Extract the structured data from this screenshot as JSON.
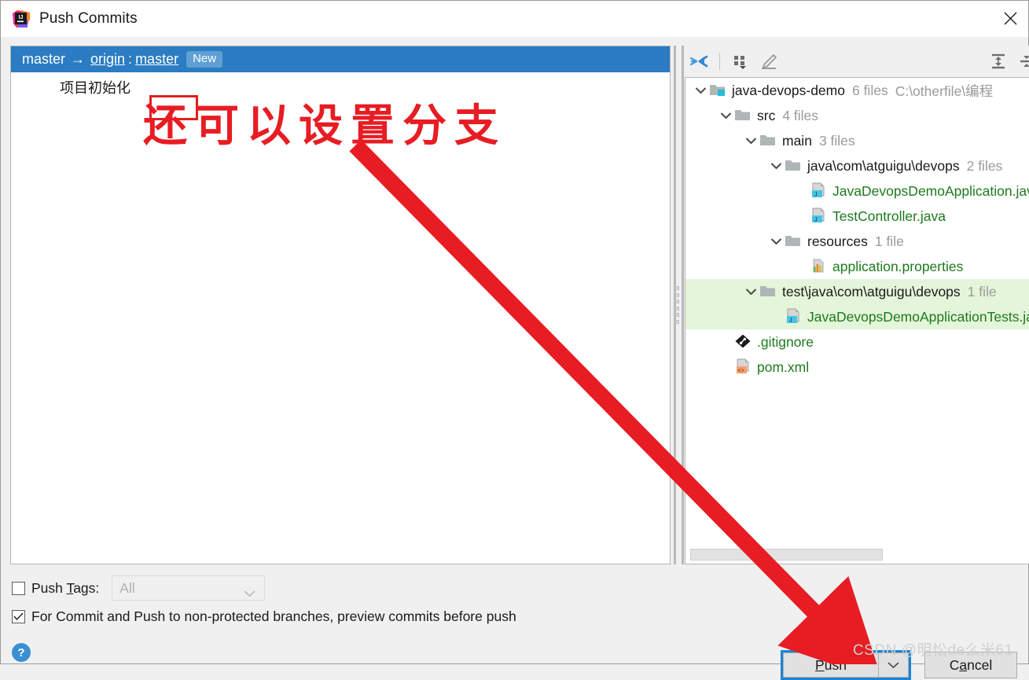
{
  "window": {
    "title": "Push Commits",
    "app_icon": "intellij-idea-icon",
    "close_label": "✕"
  },
  "commits_panel": {
    "header": {
      "local_branch": "master",
      "arrow": "→",
      "remote": "origin",
      "separator": ":",
      "remote_branch": "master",
      "badge": "New"
    },
    "commits": [
      {
        "message": "项目初始化"
      }
    ]
  },
  "tree_toolbar": {
    "buttons": [
      {
        "name": "collapse-all-icon",
        "title": "Collapse All"
      },
      {
        "name": "group-by-icon",
        "title": "Group By"
      },
      {
        "name": "edit-icon",
        "title": "Edit Source"
      },
      {
        "name": "expand-all-icon",
        "title": "Expand All"
      },
      {
        "name": "collapse-icon",
        "title": "Collapse"
      }
    ]
  },
  "file_tree": {
    "nodes": [
      {
        "indent": 0,
        "twisty": "expanded",
        "icon": "module-folder-icon",
        "name": "java-devops-demo",
        "meta": "6 files",
        "path": "C:\\otherfile\\编程",
        "type": "folder",
        "selected": false
      },
      {
        "indent": 1,
        "twisty": "expanded",
        "icon": "folder-icon",
        "name": "src",
        "meta": "4 files",
        "path": "",
        "type": "folder",
        "selected": false
      },
      {
        "indent": 2,
        "twisty": "expanded",
        "icon": "folder-icon",
        "name": "main",
        "meta": "3 files",
        "path": "",
        "type": "folder",
        "selected": false
      },
      {
        "indent": 3,
        "twisty": "expanded",
        "icon": "folder-icon",
        "name": "java\\com\\atguigu\\devops",
        "meta": "2 files",
        "path": "",
        "type": "folder",
        "selected": false
      },
      {
        "indent": 4,
        "twisty": "none",
        "icon": "java-file-icon",
        "name": "JavaDevopsDemoApplication.java",
        "meta": "",
        "path": "",
        "type": "file",
        "selected": false
      },
      {
        "indent": 4,
        "twisty": "none",
        "icon": "java-file-icon",
        "name": "TestController.java",
        "meta": "",
        "path": "",
        "type": "file",
        "selected": false
      },
      {
        "indent": 3,
        "twisty": "expanded",
        "icon": "folder-icon",
        "name": "resources",
        "meta": "1 file",
        "path": "",
        "type": "folder",
        "selected": false
      },
      {
        "indent": 4,
        "twisty": "none",
        "icon": "properties-file-icon",
        "name": "application.properties",
        "meta": "",
        "path": "",
        "type": "file",
        "selected": false
      },
      {
        "indent": 2,
        "twisty": "expanded",
        "icon": "folder-icon",
        "name": "test\\java\\com\\atguigu\\devops",
        "meta": "1 file",
        "path": "",
        "type": "folder",
        "selected": true
      },
      {
        "indent": 3,
        "twisty": "none",
        "icon": "java-file-icon",
        "name": "JavaDevopsDemoApplicationTests.java",
        "meta": "",
        "path": "",
        "type": "file",
        "selected": true
      },
      {
        "indent": 1,
        "twisty": "none",
        "icon": "git-file-icon",
        "name": ".gitignore",
        "meta": "",
        "path": "",
        "type": "file",
        "selected": false
      },
      {
        "indent": 1,
        "twisty": "none",
        "icon": "xml-file-icon",
        "name": "pom.xml",
        "meta": "",
        "path": "",
        "type": "file",
        "selected": false
      }
    ]
  },
  "footer": {
    "push_tags": {
      "label_pre": "Push ",
      "label_mnemonic": "T",
      "label_post": "ags:",
      "checked": false,
      "combo_value": "All",
      "combo_enabled": false
    },
    "preview_commits": {
      "label": "For Commit and Push to non-protected branches, preview commits before push",
      "checked": true
    },
    "help": "?",
    "push_button": {
      "pre": "",
      "mnemonic": "P",
      "post": "ush"
    },
    "push_dropdown": "⌄",
    "cancel_button": {
      "pre": "C",
      "mnemonic": "a",
      "post": "ncel"
    }
  },
  "annotations": {
    "chinese_note": "还可以设置分支",
    "watermark": "CSDN @明忪de么米61",
    "arrow_color": "#e81c23",
    "highlight_box_color": "#e02020",
    "focus_ring_color": "#1a84d8"
  }
}
